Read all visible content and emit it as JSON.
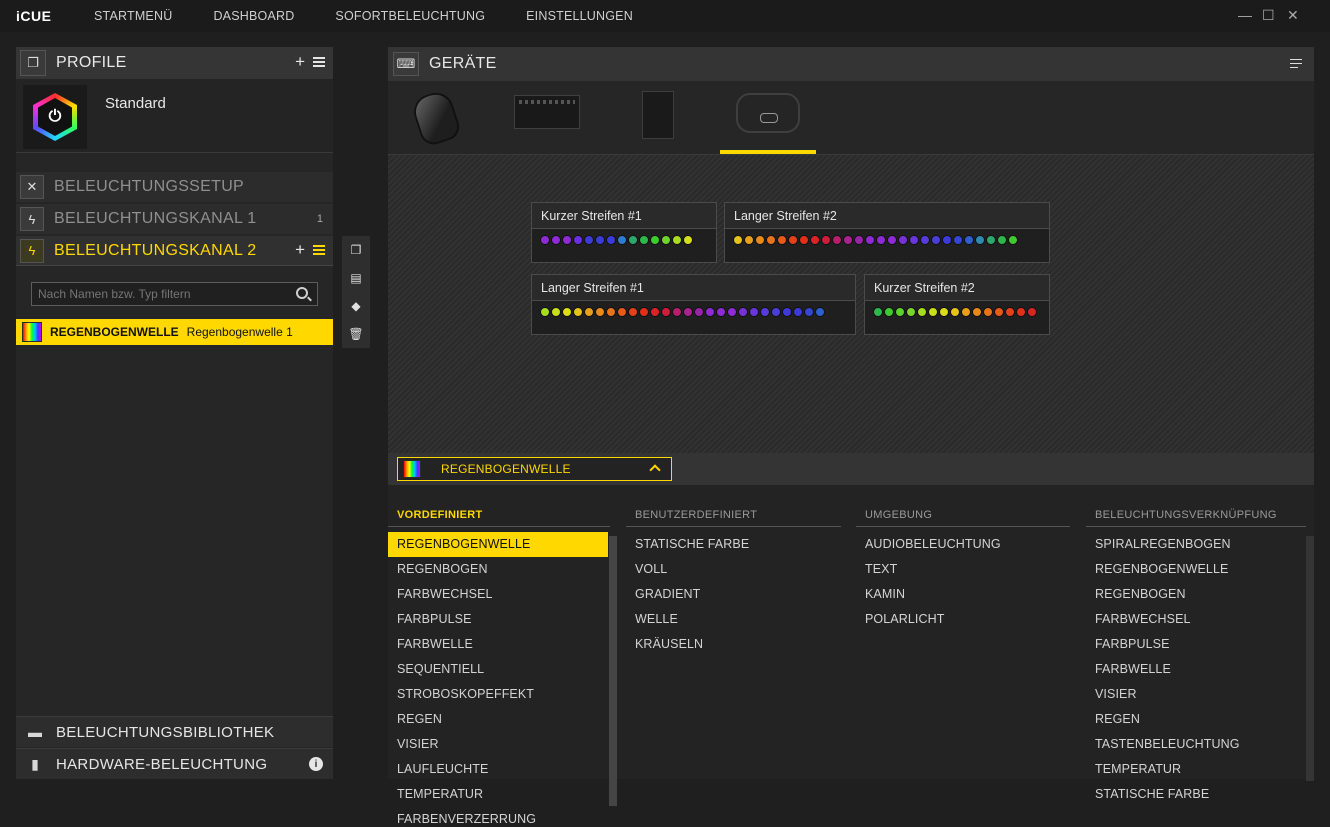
{
  "app": {
    "logo": "iCUE"
  },
  "nav": [
    "STARTMENÜ",
    "DASHBOARD",
    "SOFORTBELEUCHTUNG",
    "EINSTELLUNGEN"
  ],
  "window": {
    "minimize": "—",
    "maximize": "☐",
    "close": "✕"
  },
  "left": {
    "profile_header": "PROFILE",
    "add": "+",
    "profile_name": "Standard",
    "rows": [
      {
        "label": "BELEUCHTUNGSSETUP",
        "badge": ""
      },
      {
        "label": "BELEUCHTUNGSKANAL 1",
        "badge": "1"
      },
      {
        "label": "BELEUCHTUNGSKANAL 2",
        "badge": ""
      }
    ],
    "filter_placeholder": "Nach Namen bzw. Typ filtern",
    "effect": {
      "name": "REGENBOGENWELLE",
      "instance": "Regenbogenwelle 1"
    },
    "bottom": [
      "BELEUCHTUNGSBIBLIOTHEK",
      "HARDWARE-BELEUCHTUNG"
    ],
    "info": "i"
  },
  "devices": {
    "header": "GERÄTE",
    "names": [
      "mouse-device",
      "lighting-node-core",
      "commander-core",
      "lighting-node-pro"
    ]
  },
  "strips": [
    {
      "title": "Kurzer Streifen #1",
      "leds": [
        "#8e2bd4",
        "#8e2bd4",
        "#8e2bd4",
        "#6a2fe0",
        "#3b3bd8",
        "#3b3bd8",
        "#3b3bd8",
        "#2e7bd0",
        "#2da86a",
        "#2db84a",
        "#3dcc2d",
        "#6fd42d",
        "#a8dc1e",
        "#d4e01a"
      ]
    },
    {
      "title": "Langer Streifen #2",
      "leds": [
        "#e6c21a",
        "#e8a01a",
        "#e88a1a",
        "#e8741a",
        "#e65a1a",
        "#e5401a",
        "#e0301a",
        "#d82424",
        "#cc1e3a",
        "#b81e6a",
        "#a82290",
        "#9a24a8",
        "#8e2bd4",
        "#8e2bd4",
        "#8e2bd4",
        "#7a30d8",
        "#6a35dc",
        "#5a3adc",
        "#4a3ed8",
        "#3b3bd8",
        "#3446d4",
        "#2e5fd0",
        "#2d8ab0",
        "#2da86a",
        "#2db84a",
        "#3dcc2d"
      ]
    },
    {
      "title": "Langer Streifen #1",
      "leds": [
        "#a8dc1e",
        "#c8e01a",
        "#dcdc1a",
        "#e6c21a",
        "#e8a01a",
        "#e88a1a",
        "#e8741a",
        "#e65a1a",
        "#e5401a",
        "#e0301a",
        "#d82424",
        "#cc1e3a",
        "#b81e6a",
        "#a82290",
        "#9a24a8",
        "#8e2bd4",
        "#8e2bd4",
        "#8e2bd4",
        "#7a30d8",
        "#6a35dc",
        "#5a3adc",
        "#4a3ed8",
        "#3b3bd8",
        "#3b3bd8",
        "#3446d4",
        "#2e5fd0"
      ]
    },
    {
      "title": "Kurzer Streifen #2",
      "leds": [
        "#2db84a",
        "#3dcc2d",
        "#5ad42d",
        "#7ad42d",
        "#a8dc1e",
        "#c8e01a",
        "#dcdc1a",
        "#e6c21a",
        "#e8a01a",
        "#e88a1a",
        "#e8741a",
        "#e65a1a",
        "#e5401a",
        "#e0301a",
        "#d82424"
      ]
    }
  ],
  "effect_select": {
    "label": "REGENBOGENWELLE"
  },
  "catalog": {
    "columns": [
      {
        "head": "VORDEFINIERT",
        "items": [
          "REGENBOGENWELLE",
          "REGENBOGEN",
          "FARBWECHSEL",
          "FARBPULSE",
          "FARBWELLE",
          "SEQUENTIELL",
          "STROBOSKOPEFFEKT",
          "REGEN",
          "VISIER",
          "LAUFLEUCHTE",
          "TEMPERATUR",
          "FARBENVERZERRUNG"
        ]
      },
      {
        "head": "BENUTZERDEFINIERT",
        "items": [
          "STATISCHE FARBE",
          "VOLL",
          "GRADIENT",
          "WELLE",
          "KRÄUSELN"
        ]
      },
      {
        "head": "UMGEBUNG",
        "items": [
          "AUDIOBELEUCHTUNG",
          "TEXT",
          "KAMIN",
          "POLARLICHT"
        ]
      },
      {
        "head": "BELEUCHTUNGSVERKNÜPFUNG",
        "items": [
          "SPIRALREGENBOGEN",
          "REGENBOGENWELLE",
          "REGENBOGEN",
          "FARBWECHSEL",
          "FARBPULSE",
          "FARBWELLE",
          "VISIER",
          "REGEN",
          "TASTENBELEUCHTUNG",
          "TEMPERATUR",
          "STATISCHE FARBE"
        ]
      }
    ]
  },
  "colors": {
    "accent": "#ffd800",
    "bg": "#1f1f1f",
    "panel": "#262626"
  }
}
